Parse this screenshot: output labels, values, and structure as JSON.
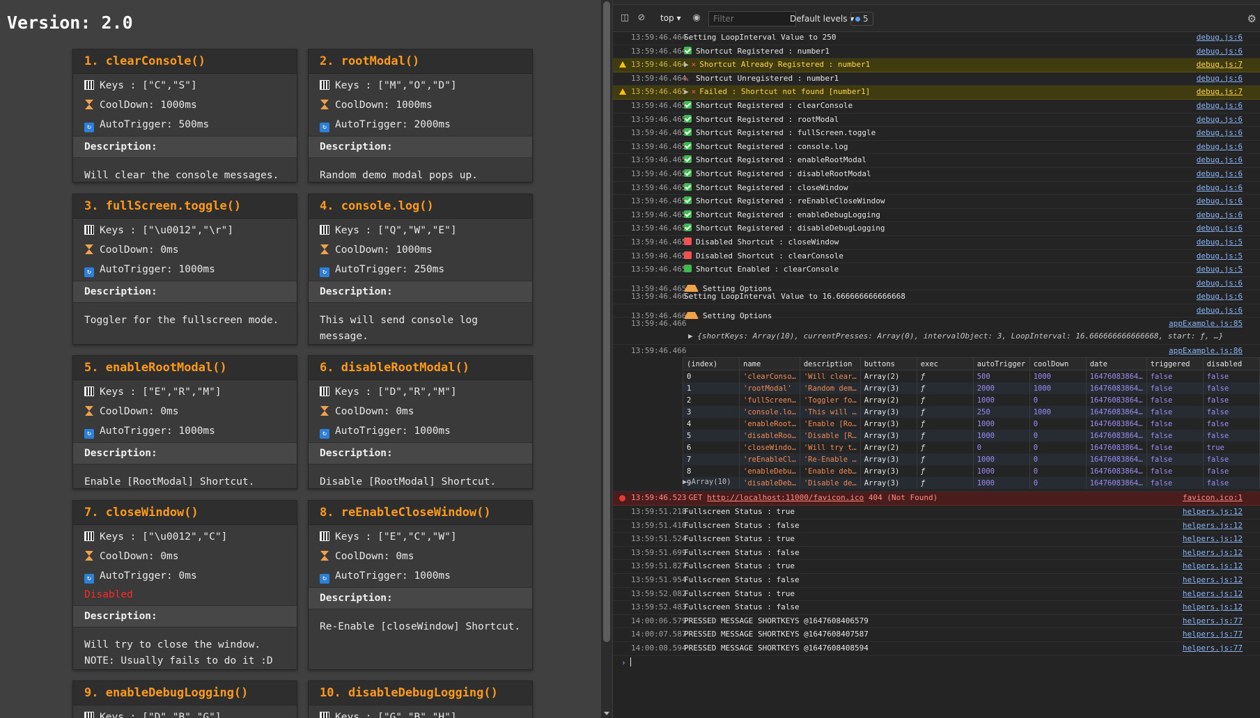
{
  "page": {
    "title": "Version: 2.0",
    "keys_label": "Keys : ",
    "cooldown_label": "CoolDown: ",
    "autotrigger_label": "AutoTrigger: ",
    "description_label": "Description:",
    "disabled_label": "Disabled",
    "cards": [
      {
        "title": "1. clearConsole()",
        "keys": "[\"C\",\"S\"]",
        "cooldown": "1000ms",
        "autotrigger": "500ms",
        "description": "Will clear the console messages.",
        "disabled": false
      },
      {
        "title": "2. rootModal()",
        "keys": "[\"M\",\"O\",\"D\"]",
        "cooldown": "1000ms",
        "autotrigger": "2000ms",
        "description": "Random demo modal pops up.",
        "disabled": false
      },
      {
        "title": "3. fullScreen.toggle()",
        "keys": "[\"\\u0012\",\"\\r\"]",
        "cooldown": "0ms",
        "autotrigger": "1000ms",
        "description": "Toggler for the fullscreen mode.",
        "disabled": false
      },
      {
        "title": "4. console.log()",
        "keys": "[\"Q\",\"W\",\"E\"]",
        "cooldown": "1000ms",
        "autotrigger": "250ms",
        "description": "This will send console log message.",
        "disabled": false
      },
      {
        "title": "5. enableRootModal()",
        "keys": "[\"E\",\"R\",\"M\"]",
        "cooldown": "0ms",
        "autotrigger": "1000ms",
        "description": "Enable [RootModal] Shortcut.",
        "disabled": false
      },
      {
        "title": "6. disableRootModal()",
        "keys": "[\"D\",\"R\",\"M\"]",
        "cooldown": "0ms",
        "autotrigger": "1000ms",
        "description": "Disable [RootModal] Shortcut.",
        "disabled": false
      },
      {
        "title": "7. closeWindow()",
        "keys": "[\"\\u0012\",\"C\"]",
        "cooldown": "0ms",
        "autotrigger": "0ms",
        "description": "Will try to close the window.\nNOTE: Usually fails to do it :D",
        "disabled": true
      },
      {
        "title": "8. reEnableCloseWindow()",
        "keys": "[\"E\",\"C\",\"W\"]",
        "cooldown": "0ms",
        "autotrigger": "1000ms",
        "description": "Re-Enable [closeWindow] Shortcut.",
        "disabled": false
      },
      {
        "title": "9. enableDebugLogging()",
        "keys": "[\"D\",\"B\",\"G\"]",
        "cooldown": "",
        "autotrigger": "",
        "description": "",
        "disabled": false
      },
      {
        "title": "10. disableDebugLogging()",
        "keys": "[\"G\",\"B\",\"H\"]",
        "cooldown": "",
        "autotrigger": "",
        "description": "",
        "disabled": false
      }
    ]
  },
  "devtools": {
    "context": "top",
    "filter_placeholder": "Filter",
    "levels": "Default levels",
    "issues_count": "5",
    "logs_top": [
      {
        "ts": "13:59:46.464",
        "type": "plain",
        "text": "Setting LoopInterval Value to 250",
        "src": "debug.js:6"
      },
      {
        "ts": "13:59:46.464",
        "type": "check",
        "text": "Shortcut Registered : number1",
        "src": "debug.js:6"
      },
      {
        "ts": "13:59:46.464",
        "type": "warn",
        "text": "Shortcut Already Registered : number1",
        "src": "debug.js:7"
      },
      {
        "ts": "13:59:46.464",
        "type": "pencil",
        "text": "Shortcut Unregistered : number1",
        "src": "debug.js:6"
      },
      {
        "ts": "13:59:46.465",
        "type": "warn",
        "text": "Failed : Shortcut not found [number1]",
        "src": "debug.js:7"
      },
      {
        "ts": "13:59:46.465",
        "type": "check",
        "text": "Shortcut Registered : clearConsole",
        "src": "debug.js:6"
      },
      {
        "ts": "13:59:46.465",
        "type": "check",
        "text": "Shortcut Registered : rootModal",
        "src": "debug.js:6"
      },
      {
        "ts": "13:59:46.465",
        "type": "check",
        "text": "Shortcut Registered : fullScreen.toggle",
        "src": "debug.js:6"
      },
      {
        "ts": "13:59:46.465",
        "type": "check",
        "text": "Shortcut Registered : console.log",
        "src": "debug.js:6"
      },
      {
        "ts": "13:59:46.465",
        "type": "check",
        "text": "Shortcut Registered : enableRootModal",
        "src": "debug.js:6"
      },
      {
        "ts": "13:59:46.465",
        "type": "check",
        "text": "Shortcut Registered : disableRootModal",
        "src": "debug.js:6"
      },
      {
        "ts": "13:59:46.465",
        "type": "check",
        "text": "Shortcut Registered : closeWindow",
        "src": "debug.js:6"
      },
      {
        "ts": "13:59:46.465",
        "type": "check",
        "text": "Shortcut Registered : reEnableCloseWindow",
        "src": "debug.js:6"
      },
      {
        "ts": "13:59:46.465",
        "type": "check",
        "text": "Shortcut Registered : enableDebugLogging",
        "src": "debug.js:6"
      },
      {
        "ts": "13:59:46.465",
        "type": "check",
        "text": "Shortcut Registered : disableDebugLogging",
        "src": "debug.js:6"
      },
      {
        "ts": "13:59:46.465",
        "type": "red",
        "text": "Disabled Shortcut : closeWindow",
        "src": "debug.js:5"
      },
      {
        "ts": "13:59:46.465",
        "type": "red",
        "text": "Disabled Shortcut : clearConsole",
        "src": "debug.js:5"
      },
      {
        "ts": "13:59:46.465",
        "type": "green",
        "text": "Shortcut Enabled : clearConsole",
        "src": "debug.js:5"
      },
      {
        "ts": "13:59:46.465",
        "type": "tri",
        "text": "Setting Options",
        "src": "debug.js:6"
      },
      {
        "ts": "13:59:46.466",
        "type": "plain",
        "text": "Setting LoopInterval Value to 16.666666666666668",
        "src": "debug.js:6"
      },
      {
        "ts": "13:59:46.466",
        "type": "tri",
        "text": "Setting Options",
        "src": "debug.js:6"
      }
    ],
    "object_log": {
      "ts": "13:59:46.466",
      "src": "appExample.js:85",
      "text": "▶ {shortKeys: Array(10), currentPresses: Array(0), intervalObject: 3, LoopInterval: 16.666666666666668, start: ƒ, …}"
    },
    "table_log": {
      "ts": "13:59:46.466",
      "src": "appExample.js:86",
      "headers": [
        "(index)",
        "name",
        "description",
        "buttons",
        "exec",
        "autoTrigger",
        "coolDown",
        "date",
        "triggered",
        "disabled"
      ],
      "rows": [
        [
          "0",
          "'clearConso…",
          "'Will clear…",
          "Array(2)",
          "ƒ",
          "500",
          "1000",
          "16476083864…",
          "false",
          "false"
        ],
        [
          "1",
          "'rootModal'",
          "'Random dem…",
          "Array(3)",
          "ƒ",
          "2000",
          "1000",
          "16476083864…",
          "false",
          "false"
        ],
        [
          "2",
          "'fullScreen…",
          "'Toggler fo…",
          "Array(2)",
          "ƒ",
          "1000",
          "0",
          "16476083864…",
          "false",
          "false"
        ],
        [
          "3",
          "'console.lo…",
          "'This will …",
          "Array(3)",
          "ƒ",
          "250",
          "1000",
          "16476083864…",
          "false",
          "false"
        ],
        [
          "4",
          "'enableRoot…",
          "'Enable [Ro…",
          "Array(3)",
          "ƒ",
          "1000",
          "0",
          "16476083864…",
          "false",
          "false"
        ],
        [
          "5",
          "'disableRoo…",
          "'Disable [R…",
          "Array(3)",
          "ƒ",
          "1000",
          "0",
          "16476083864…",
          "false",
          "false"
        ],
        [
          "6",
          "'closeWindo…",
          "'Will try t…",
          "Array(2)",
          "ƒ",
          "0",
          "0",
          "16476083864…",
          "false",
          "true"
        ],
        [
          "7",
          "'reEnableCl…",
          "'Re-Enable …",
          "Array(3)",
          "ƒ",
          "1000",
          "0",
          "16476083864…",
          "false",
          "false"
        ],
        [
          "8",
          "'enableDebu…",
          "'Enable deb…",
          "Array(3)",
          "ƒ",
          "1000",
          "0",
          "16476083864…",
          "false",
          "false"
        ],
        [
          "9",
          "'disableDeb…",
          "'Disable de…",
          "Array(3)",
          "ƒ",
          "1000",
          "0",
          "16476083864…",
          "false",
          "false"
        ]
      ],
      "footer": "▶ Array(10)"
    },
    "error_log": {
      "ts": "13:59:46.523",
      "method": "GET",
      "url": "http://localhost:11000/favicon.ico",
      "status": "404 (Not Found)",
      "src": "favicon.ico:1"
    },
    "logs_bottom": [
      {
        "ts": "13:59:51.218",
        "text": "Fullscreen Status : true",
        "src": "helpers.js:12"
      },
      {
        "ts": "13:59:51.410",
        "text": "Fullscreen Status : false",
        "src": "helpers.js:12"
      },
      {
        "ts": "13:59:51.524",
        "text": "Fullscreen Status : true",
        "src": "helpers.js:12"
      },
      {
        "ts": "13:59:51.699",
        "text": "Fullscreen Status : false",
        "src": "helpers.js:12"
      },
      {
        "ts": "13:59:51.827",
        "text": "Fullscreen Status : true",
        "src": "helpers.js:12"
      },
      {
        "ts": "13:59:51.954",
        "text": "Fullscreen Status : false",
        "src": "helpers.js:12"
      },
      {
        "ts": "13:59:52.082",
        "text": "Fullscreen Status : true",
        "src": "helpers.js:12"
      },
      {
        "ts": "13:59:52.483",
        "text": "Fullscreen Status : false",
        "src": "helpers.js:12"
      },
      {
        "ts": "14:00:06.579",
        "text": "PRESSED MESSAGE SHORTKEYS @1647608406579",
        "src": "helpers.js:77"
      },
      {
        "ts": "14:00:07.587",
        "text": "PRESSED MESSAGE SHORTKEYS @1647608407587",
        "src": "helpers.js:77"
      },
      {
        "ts": "14:00:08.594",
        "text": "PRESSED MESSAGE SHORTKEYS @1647608408594",
        "src": "helpers.js:77"
      }
    ]
  }
}
